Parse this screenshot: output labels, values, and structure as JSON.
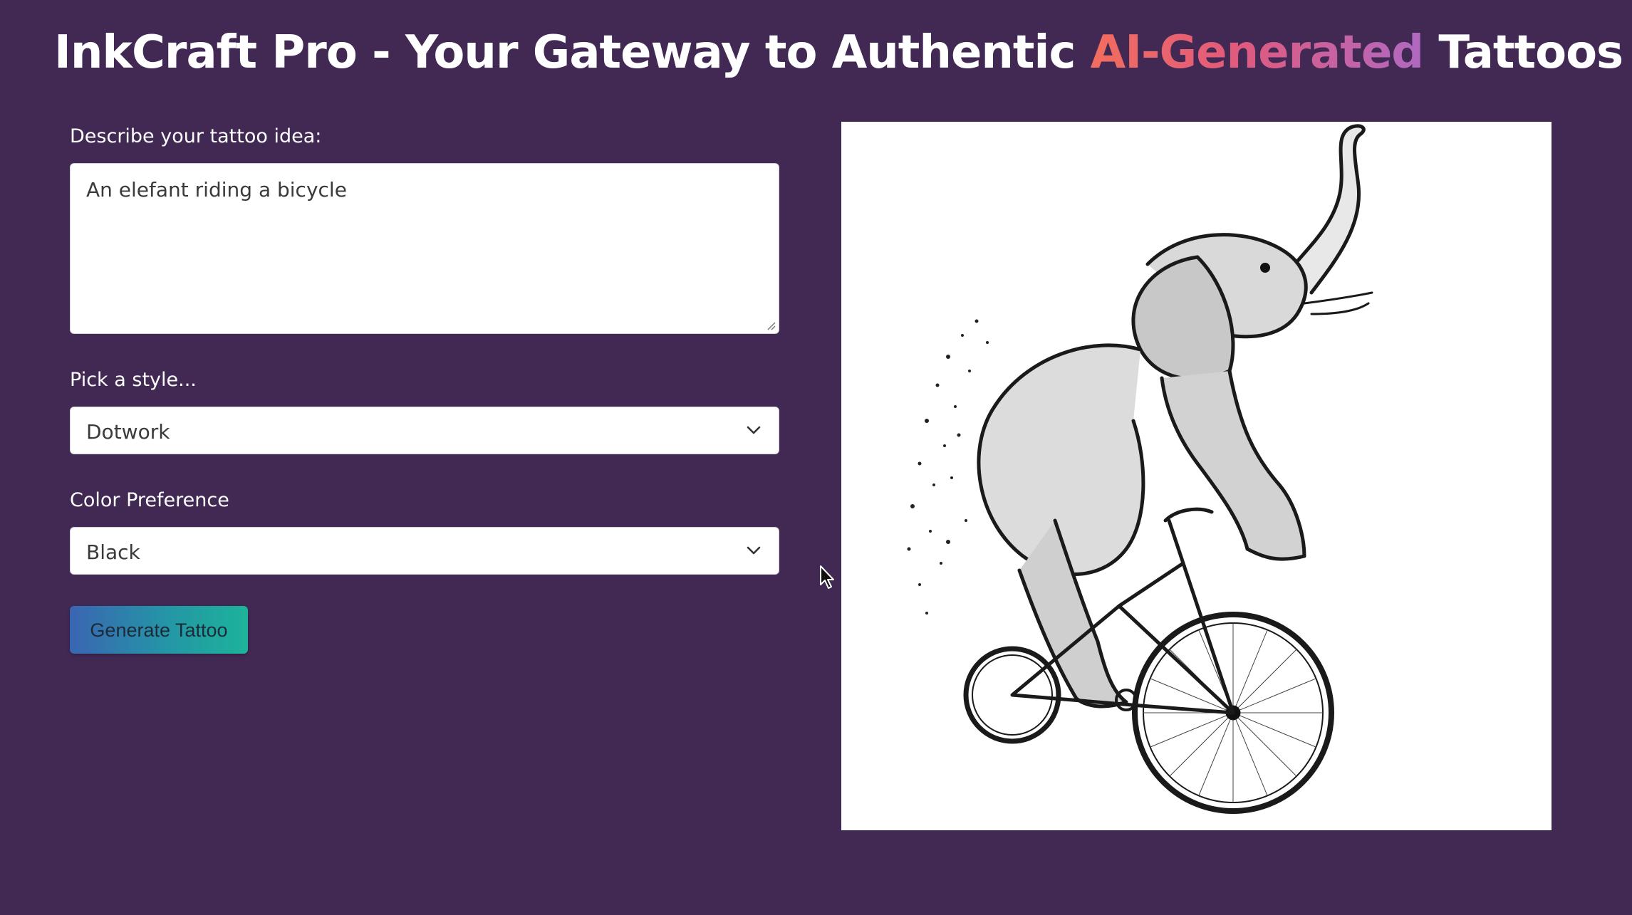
{
  "header": {
    "title_prefix": "InkCraft Pro - Your Gateway to Authentic ",
    "title_accent": "AI-Generated",
    "title_suffix": " Tattoos"
  },
  "form": {
    "idea_label": "Describe your tattoo idea:",
    "idea_value": "An elefant riding a bicycle",
    "style_label": "Pick a style...",
    "style_value": "Dotwork",
    "color_label": "Color Preference",
    "color_value": "Black",
    "generate_label": "Generate Tattoo"
  },
  "colors": {
    "background": "#412954",
    "accent_gradient_start": "#f36d5e",
    "accent_gradient_end": "#b069c2",
    "button_gradient_start": "#3a65b3",
    "button_gradient_end": "#1db39a"
  },
  "icons": {
    "select_arrow": "chevron-down-icon",
    "cursor": "mouse-pointer-icon"
  }
}
